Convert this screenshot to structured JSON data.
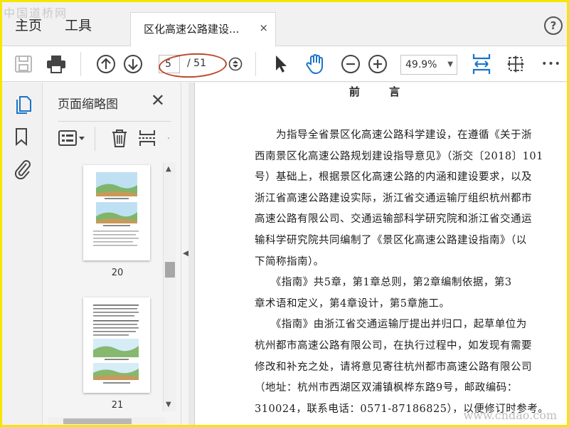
{
  "watermark": {
    "top": "中国道桥网",
    "bottom": "www.cndao.com"
  },
  "menubar": {
    "home": "主页",
    "tools": "工具",
    "tab_title": "区化高速公路建设...",
    "tab_close": "×",
    "help": "?"
  },
  "toolbar": {
    "page_current": "5",
    "page_total": "/ 51",
    "zoom": "49.9%",
    "more": "•••"
  },
  "panel": {
    "title": "页面缩略图",
    "close": "✕",
    "thumbnails": [
      {
        "label": "20"
      },
      {
        "label": "21"
      }
    ]
  },
  "document": {
    "heading": "前 言",
    "lines": [
      "　　为指导全省景区化高速公路科学建设，在遵循《关于浙",
      "西南景区化高速公路规划建设指导意见》（浙交〔2018〕101",
      "号）基础上，根据景区化高速公路的内涵和建设要求，以及",
      "浙江省高速公路建设实际，浙江省交通运输厅组织杭州都市",
      "高速公路有限公司、交通运输部科学研究院和浙江省交通运",
      "输科学研究院共同编制了《景区化高速公路建设指南》（以",
      "下简称指南）。",
      "　　《指南》共5章，第1章总则，第2章编制依据，第3",
      "章术语和定义，第4章设计，第5章施工。",
      "　　《指南》由浙江省交通运输厅提出并归口，起草单位为",
      "杭州都市高速公路有限公司，在执行过程中，如发现有需要",
      "修改和补充之处，请将意见寄往杭州都市高速公路有限公司",
      "（地址：杭州市西湖区双浦镇枫桦东路9号，邮政编码：",
      "310024，联系电话：0571-87186825），以便修订时参考。"
    ]
  },
  "colors": {
    "frame": "#f5e600",
    "accent_blue": "#1a73c9",
    "annotation_red": "#b84a2c"
  }
}
